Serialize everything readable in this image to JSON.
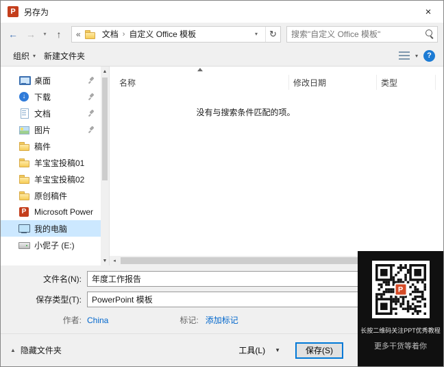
{
  "window": {
    "title": "另存为"
  },
  "icons": {
    "close": "×",
    "back": "←",
    "forward": "→",
    "nav_dropdown": "▾",
    "up": "↑",
    "chevrons_overflow": "«",
    "crumb_separator": "›",
    "address_dropdown": "▾",
    "refresh": "↻",
    "organize_caret": "▾",
    "views_caret": "▾",
    "help": "?",
    "scroll_up": "▲",
    "scroll_down": "▼",
    "scroll_left": "◂",
    "scroll_right": "▸",
    "hide_folders_caret": "▲",
    "tools_caret": "▼",
    "filetype_caret": "▾"
  },
  "navbar": {
    "breadcrumb": {
      "items": [
        {
          "label": "文档"
        },
        {
          "label": "自定义 Office 模板"
        }
      ]
    },
    "search": {
      "placeholder": "搜索\"自定义 Office 模板\""
    }
  },
  "toolbar": {
    "organize_label": "组织",
    "new_folder_label": "新建文件夹"
  },
  "sidebar": {
    "items": [
      {
        "label": "桌面",
        "icon": "desktop",
        "pinned": true
      },
      {
        "label": "下载",
        "icon": "download",
        "pinned": true
      },
      {
        "label": "文档",
        "icon": "document",
        "pinned": true
      },
      {
        "label": "图片",
        "icon": "picture",
        "pinned": true
      },
      {
        "label": "稿件",
        "icon": "folder",
        "pinned": false
      },
      {
        "label": "羊宝宝投稿01",
        "icon": "folder",
        "pinned": false
      },
      {
        "label": "羊宝宝投稿02",
        "icon": "folder",
        "pinned": false
      },
      {
        "label": "原创稿件",
        "icon": "folder",
        "pinned": false
      },
      {
        "label": "Microsoft Power",
        "icon": "powerpoint",
        "pinned": false
      },
      {
        "label": "我的电脑",
        "icon": "computer",
        "pinned": false,
        "selected": true
      },
      {
        "label": "小伲子 (E:)",
        "icon": "drive",
        "pinned": false
      }
    ]
  },
  "filelist": {
    "columns": [
      {
        "label": "名称"
      },
      {
        "label": "修改日期"
      },
      {
        "label": "类型"
      }
    ],
    "empty_message": "没有与搜索条件匹配的项。"
  },
  "form": {
    "filename": {
      "label": "文件名(N):",
      "value": "年度工作报告"
    },
    "filetype": {
      "label": "保存类型(T):",
      "value": "PowerPoint 模板"
    },
    "author": {
      "label": "作者:",
      "value": "China"
    },
    "tags": {
      "label": "标记:",
      "value": "添加标记"
    }
  },
  "footer": {
    "hide_folders_label": "隐藏文件夹",
    "tools_label": "工具(L)",
    "save_label": "保存(S)"
  },
  "qr_overlay": {
    "line1": "长按二维码关注PPT优秀教程",
    "line2": "更多干货等着你",
    "brand_letter": "P"
  },
  "colors": {
    "accent_blue": "#0078d7",
    "selection_bg": "#cce8ff",
    "link_blue": "#0066cc",
    "powerpoint_red": "#c43e1c"
  }
}
